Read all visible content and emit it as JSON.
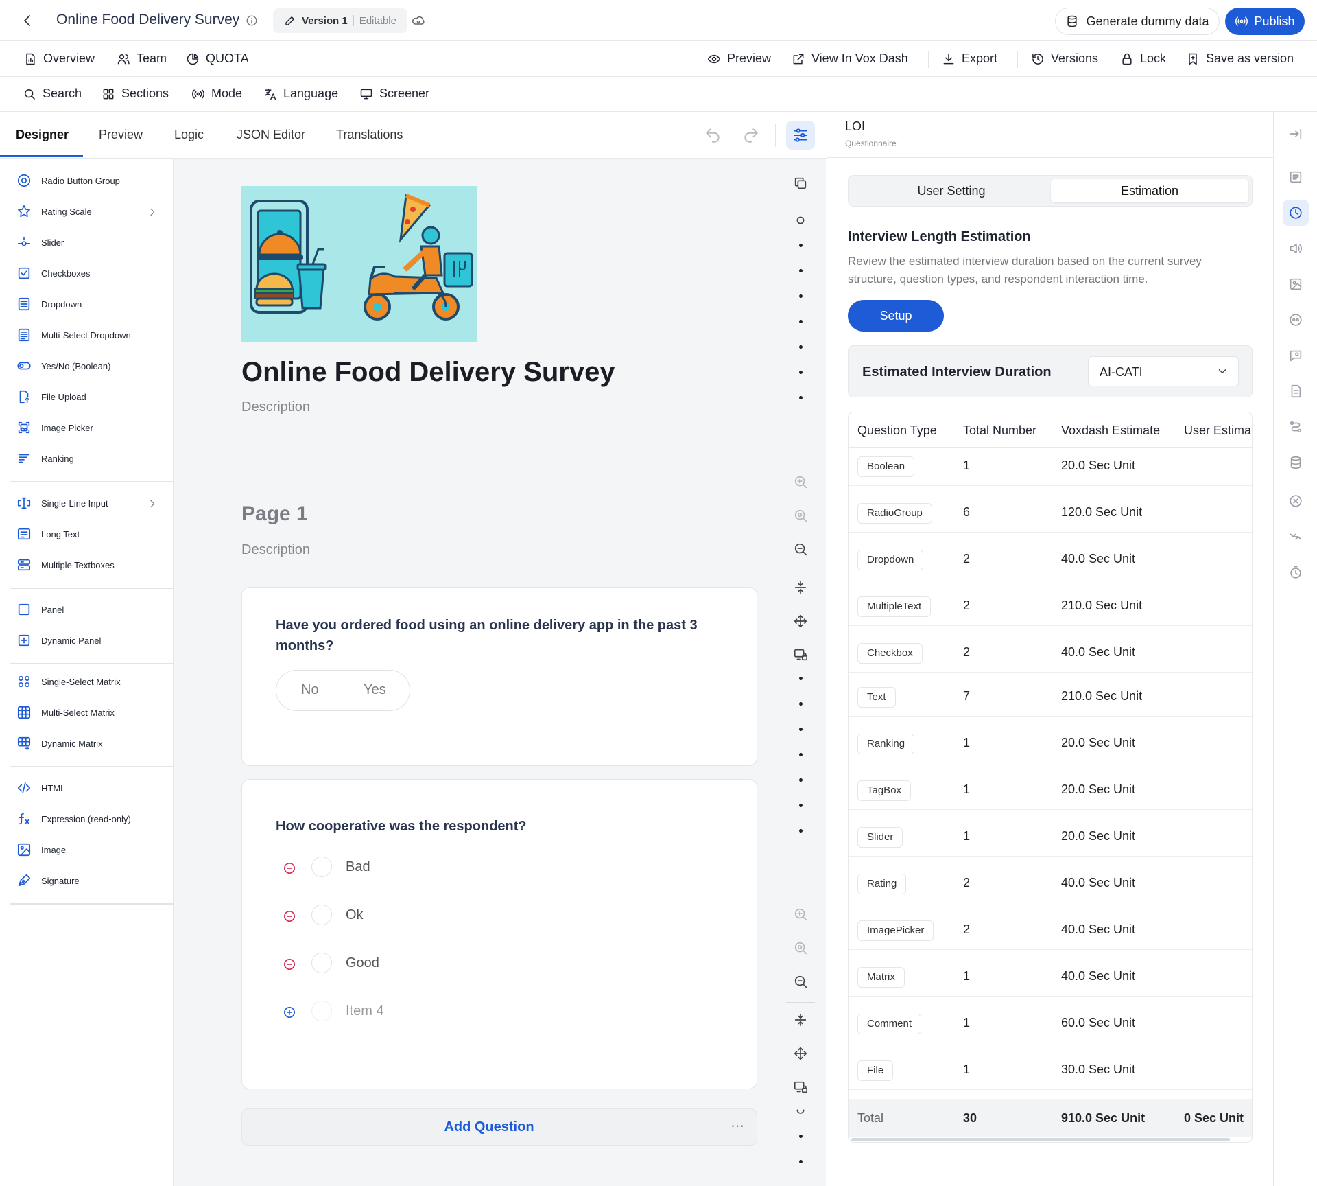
{
  "header": {
    "title": "Online Food Delivery Survey",
    "version_label": "Version 1",
    "version_status": "Editable",
    "generate_label": "Generate dummy data",
    "publish_label": "Publish"
  },
  "nav": {
    "left": [
      {
        "label": "Overview",
        "icon": "file-report-icon"
      },
      {
        "label": "Team",
        "icon": "users-icon"
      },
      {
        "label": "QUOTA",
        "icon": "pie-chart-icon"
      }
    ],
    "right": [
      {
        "label": "Preview",
        "icon": "eye-icon"
      },
      {
        "label": "View In Vox Dash",
        "icon": "external-link-icon"
      },
      {
        "label": "Export",
        "icon": "download-icon"
      },
      {
        "label": "Versions",
        "icon": "history-icon"
      },
      {
        "label": "Lock",
        "icon": "lock-icon"
      },
      {
        "label": "Save as version",
        "icon": "bookmark-icon"
      }
    ]
  },
  "toolbar": [
    {
      "label": "Search",
      "icon": "search-icon"
    },
    {
      "label": "Sections",
      "icon": "grid-icon"
    },
    {
      "label": "Mode",
      "icon": "broadcast-icon"
    },
    {
      "label": "Language",
      "icon": "translate-icon"
    },
    {
      "label": "Screener",
      "icon": "monitor-icon"
    }
  ],
  "tabs": [
    {
      "label": "Designer",
      "active": true
    },
    {
      "label": "Preview"
    },
    {
      "label": "Logic"
    },
    {
      "label": "JSON Editor"
    },
    {
      "label": "Translations"
    }
  ],
  "toolbox": {
    "groups": [
      [
        "Radio Button Group",
        "Rating Scale",
        "Slider",
        "Checkboxes",
        "Dropdown",
        "Multi-Select Dropdown",
        "Yes/No (Boolean)",
        "File Upload",
        "Image Picker",
        "Ranking"
      ],
      [
        "Single-Line Input",
        "Long Text",
        "Multiple Textboxes"
      ],
      [
        "Panel",
        "Dynamic Panel"
      ],
      [
        "Single-Select Matrix",
        "Multi-Select Matrix",
        "Dynamic Matrix"
      ],
      [
        "HTML",
        "Expression (read-only)",
        "Image",
        "Signature"
      ]
    ]
  },
  "survey": {
    "title": "Online Food Delivery Survey",
    "description": "Description",
    "page_title": "Page 1",
    "page_description": "Description",
    "q1": {
      "title": "Have you ordered food using an online delivery app in the past 3 months?",
      "no_label": "No",
      "yes_label": "Yes"
    },
    "q2": {
      "title": "How cooperative was the respondent?",
      "choices": [
        "Bad",
        "Ok",
        "Good"
      ],
      "new_choice": "Item 4"
    },
    "add_question_label": "Add Question",
    "more_label": "⋯"
  },
  "right_panel": {
    "title": "LOI",
    "subtitle": "Questionnaire",
    "seg_user": "User Setting",
    "seg_estimation": "Estimation",
    "heading": "Interview Length Estimation",
    "description": "Review the estimated interview duration based on the current survey structure, question types, and respondent interaction time.",
    "setup_label": "Setup",
    "duration_label": "Estimated Interview Duration",
    "duration_mode": "AI-CATI",
    "table": {
      "headers": [
        "Question Type",
        "Total Number",
        "Voxdash Estimate",
        "User Estima"
      ],
      "rows": [
        {
          "type": "Boolean",
          "count": "1",
          "estimate": "20.0 Sec Unit"
        },
        {
          "type": "RadioGroup",
          "count": "6",
          "estimate": "120.0 Sec Unit"
        },
        {
          "type": "Dropdown",
          "count": "2",
          "estimate": "40.0 Sec Unit"
        },
        {
          "type": "MultipleText",
          "count": "2",
          "estimate": "210.0 Sec Unit"
        },
        {
          "type": "Checkbox",
          "count": "2",
          "estimate": "40.0 Sec Unit"
        },
        {
          "type": "Text",
          "count": "7",
          "estimate": "210.0 Sec Unit"
        },
        {
          "type": "Ranking",
          "count": "1",
          "estimate": "20.0 Sec Unit"
        },
        {
          "type": "TagBox",
          "count": "1",
          "estimate": "20.0 Sec Unit"
        },
        {
          "type": "Slider",
          "count": "1",
          "estimate": "20.0 Sec Unit"
        },
        {
          "type": "Rating",
          "count": "2",
          "estimate": "40.0 Sec Unit"
        },
        {
          "type": "ImagePicker",
          "count": "2",
          "estimate": "40.0 Sec Unit"
        },
        {
          "type": "Matrix",
          "count": "1",
          "estimate": "40.0 Sec Unit"
        },
        {
          "type": "Comment",
          "count": "1",
          "estimate": "60.0 Sec Unit"
        },
        {
          "type": "File",
          "count": "1",
          "estimate": "30.0 Sec Unit"
        }
      ],
      "total": {
        "label": "Total",
        "count": "30",
        "estimate": "910.0 Sec Unit",
        "user": "0 Sec Unit"
      }
    }
  },
  "colors": {
    "accent": "#1e5bd6",
    "remove": "#d6284f",
    "hero_bg": "#a9e7e8",
    "orange": "#f08a24"
  }
}
